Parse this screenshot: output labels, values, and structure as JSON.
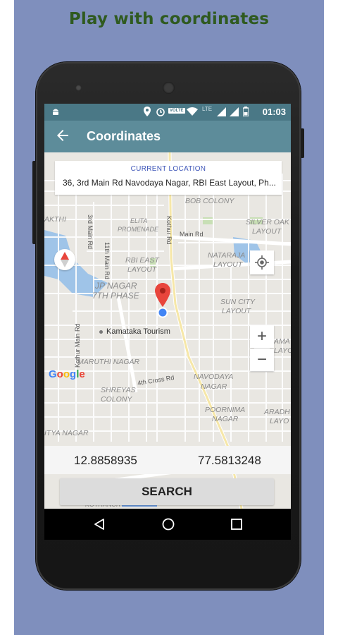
{
  "headline": "Play with coordinates",
  "status_bar": {
    "time": "01:03",
    "network": "LTE",
    "volte": "VOLTE",
    "icons": [
      "android-icon",
      "location-icon",
      "alarm-icon",
      "volte-icon",
      "wifi-icon",
      "lte-signal-icon",
      "signal-icon",
      "battery-icon"
    ]
  },
  "app_bar": {
    "title": "Coordinates",
    "back_icon": "arrow-back-icon"
  },
  "location_card": {
    "label": "CURRENT LOCATION",
    "address": "36, 3rd Main Rd Navodaya Nagar, RBI East Layout, Ph..."
  },
  "map": {
    "areas": [
      "BOB COLONY",
      "SILVER OAK",
      "LAYOUT",
      "ELITA",
      "PROMENADE",
      "AKTHI",
      "RBI EAST",
      "LAYOUT",
      "NATARAJA",
      "LAYOUT",
      "JP NAGAR",
      "7TH PHASE",
      "SUN CITY",
      "LAYOUT",
      "MARUTHI NAGAR",
      "SHREYAS",
      "COLONY",
      "NAVODAYA",
      "NAGAR",
      "POORNIMA",
      "NAGAR",
      "ARADH",
      "LAYO",
      "AMA",
      "LAYO",
      "ITYA NAGAR",
      "KOTHANUR"
    ],
    "roads": [
      "3rd Main Rd",
      "Kothur Rd",
      "Main Rd",
      "11th Main Rd",
      "Kothur Main Rd",
      "4th Cross Rd"
    ],
    "poi": "Kamataka Tourism",
    "logo": "Google",
    "zoom_in": "+",
    "zoom_out": "−",
    "compass_icon": "compass-icon",
    "my_location_icon": "my-location-icon",
    "pin_icon": "map-pin-icon"
  },
  "coordinates": {
    "latitude": "12.8858935",
    "longitude": "77.5813248"
  },
  "search_button": "SEARCH",
  "nav_bar": {
    "back_icon": "nav-back-icon",
    "home_icon": "nav-home-icon",
    "recents_icon": "nav-recents-icon"
  },
  "colors": {
    "background_panel": "#7f8fbd",
    "headline": "#2f5a1f",
    "status_bar": "#4a7886",
    "app_bar": "#5d8c9a",
    "accent_label": "#3d55b8",
    "pin": "#e8453c",
    "location_dot": "#4285f4"
  }
}
